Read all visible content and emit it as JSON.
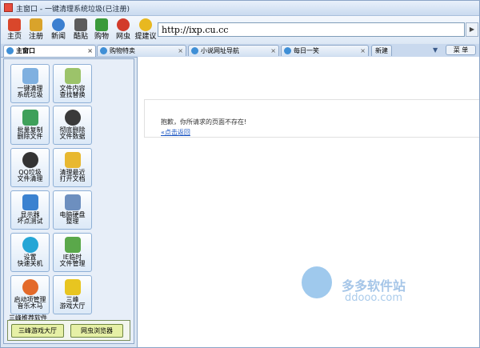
{
  "window": {
    "title": "主窗口 - 一键清理系统垃圾(已注册)"
  },
  "toolbar": [
    {
      "label": "主页",
      "icon": "home-icon",
      "color": "#d9472b"
    },
    {
      "label": "注册",
      "icon": "key-icon",
      "color": "#d9a32b"
    },
    {
      "label": "新闻",
      "icon": "globe-icon",
      "color": "#3b7fd0"
    },
    {
      "label": "酷贴",
      "icon": "book-icon",
      "color": "#5c5c5c"
    },
    {
      "label": "购物",
      "icon": "cart-icon",
      "color": "#3a9a3a"
    },
    {
      "label": "网虫",
      "icon": "bug-icon",
      "color": "#d23b2b"
    },
    {
      "label": "提建议",
      "icon": "chat-bubble-icon",
      "color": "#e8b820"
    }
  ],
  "address": {
    "value": "http://ixp.cu.cc"
  },
  "tabs": [
    {
      "label": "主窗口",
      "active": true,
      "close": "×"
    },
    {
      "label": "购物特卖",
      "active": false,
      "close": "×"
    },
    {
      "label": "小说网址导航",
      "active": false,
      "close": "×"
    },
    {
      "label": "每日一笑",
      "active": false,
      "close": "×"
    },
    {
      "label": "新建",
      "active": false,
      "close": ""
    }
  ],
  "menu_label": "菜 单",
  "sidebar": {
    "tiles": [
      {
        "label": "一键清理\n系统垃圾",
        "icon": "trash-icon",
        "color": "#7fb0e0"
      },
      {
        "label": "文件内容\n查找替换",
        "icon": "document-search-icon",
        "color": "#9cc36a"
      },
      {
        "label": "批量复制\n删除文件",
        "icon": "folders-icon",
        "color": "#3fa05a"
      },
      {
        "label": "彻底删除\n文件数据",
        "icon": "skull-icon",
        "color": "#3a3a3a"
      },
      {
        "label": "QQ垃圾\n文件清理",
        "icon": "qq-penguin-icon",
        "color": "#333333"
      },
      {
        "label": "清理最近\n打开文档",
        "icon": "folder-icon",
        "color": "#e8b830"
      },
      {
        "label": "显示器\n坏点测试",
        "icon": "monitor-icon",
        "color": "#3b82d0"
      },
      {
        "label": "电脑硬盘\n整理",
        "icon": "harddisk-icon",
        "color": "#6d8fbf"
      },
      {
        "label": "设置\n快速关机",
        "icon": "power-icon",
        "color": "#25a6d6"
      },
      {
        "label": "IE临时\n文件管理",
        "icon": "recycle-icon",
        "color": "#5aa84a"
      },
      {
        "label": "启动项管理\n音乐木马",
        "icon": "windows-icon",
        "color": "#e36a2a"
      },
      {
        "label": "三峰\n游戏大厅",
        "icon": "star-icon",
        "color": "#e8c520"
      }
    ],
    "recommend_title": "三峰推荐软件",
    "recommend_buttons": [
      "三峰游戏大厅",
      "网虫浏览器"
    ]
  },
  "page": {
    "message": "抱歉，你所请求的页面不存在!",
    "back_link": "«点击返回"
  },
  "watermark": {
    "brand": "多多软件站",
    "url": "ddooo.com"
  }
}
